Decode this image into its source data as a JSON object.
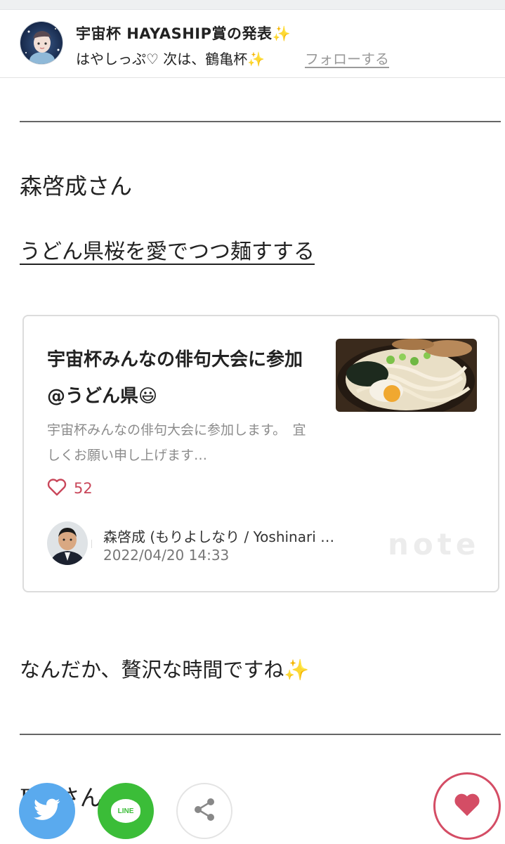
{
  "header": {
    "title": "宇宙杯 HAYASHIP賞の発表✨",
    "subtitle": "はやしっぷ♡ 次は、鶴亀杯✨",
    "follow_label": "フォローする"
  },
  "section": {
    "name": "森啓成さん",
    "article_link": "うどん県桜を愛でつつ麺すする"
  },
  "card": {
    "title": "宇宙杯みんなの俳句大会に参加@うどん県😃",
    "description": "宇宙杯みんなの俳句大会に参加します。　宜しくお願い申し上げます…",
    "likes": "52",
    "author": "森啓成 (もりよしなり / Yoshinari …",
    "date": "2022/04/20 14:33",
    "brand": "note"
  },
  "body": {
    "text": "なんだか、贅沢な時間ですね✨",
    "next_heading": "Emさん"
  },
  "share": {
    "line_label": "LINE"
  },
  "colors": {
    "twitter": "#5aaaee",
    "line": "#3bbd38",
    "like": "#d44d65",
    "likes_text": "#c9475a"
  },
  "icons": [
    "twitter-icon",
    "line-icon",
    "share-icon",
    "heart-icon"
  ]
}
